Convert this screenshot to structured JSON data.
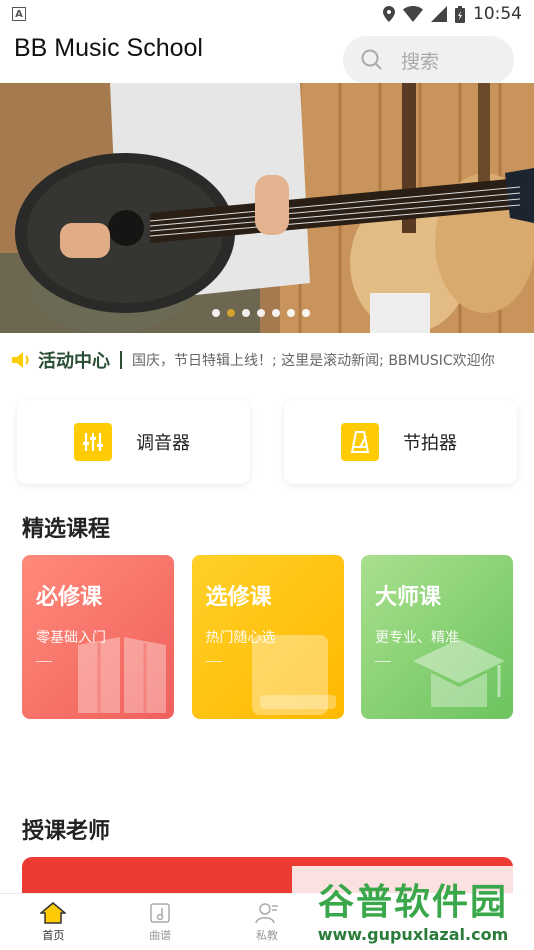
{
  "status": {
    "time": "10:54"
  },
  "header": {
    "title": "BB Music School",
    "search_placeholder": "搜索"
  },
  "banner": {
    "dots": 7,
    "active_dot": 1
  },
  "news": {
    "title": "活动中心",
    "text": "国庆，节日特辑上线！; 这里是滚动新闻; BBMUSIC欢迎你"
  },
  "tools": [
    {
      "label": "调音器",
      "icon": "tuner-icon"
    },
    {
      "label": "节拍器",
      "icon": "metronome-icon"
    }
  ],
  "sections": {
    "courses_title": "精选课程",
    "teachers_title": "授课老师"
  },
  "courses": [
    {
      "title": "必修课",
      "subtitle": "零基础入门",
      "icon": "open-book-icon",
      "color": "#f0605c"
    },
    {
      "title": "选修课",
      "subtitle": "热门随心选",
      "icon": "closed-book-icon",
      "color": "#ffb800"
    },
    {
      "title": "大师课",
      "subtitle": "更专业、精准",
      "icon": "graduation-cap-icon",
      "color": "#6cc35e"
    }
  ],
  "tabbar": [
    {
      "label": "首页",
      "icon": "home-icon",
      "active": true
    },
    {
      "label": "曲谱",
      "icon": "score-icon",
      "active": false
    },
    {
      "label": "私教",
      "icon": "private-tutor-icon",
      "active": false
    },
    {
      "label": "",
      "icon": "",
      "active": false
    },
    {
      "label": "",
      "icon": "",
      "active": false
    }
  ],
  "watermark": {
    "brand": "谷普软件园",
    "url": "www.gupuxlazal.com"
  }
}
